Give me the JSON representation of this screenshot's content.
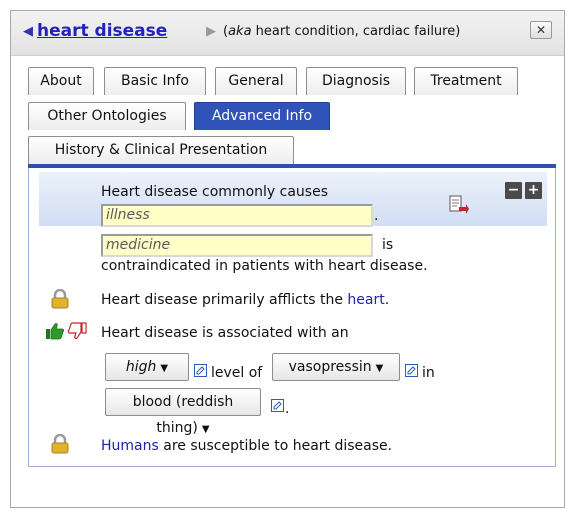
{
  "header": {
    "topic": "heart disease",
    "aka_prefix": "aka",
    "aka_text": " heart condition, cardiac failure)",
    "aka_open": "(",
    "close_label": "✕"
  },
  "tabs": [
    {
      "label": "About"
    },
    {
      "label": "Basic Info"
    },
    {
      "label": "General"
    },
    {
      "label": "Diagnosis"
    },
    {
      "label": "Treatment"
    },
    {
      "label": "Other Ontologies"
    },
    {
      "label": "Advanced Info"
    },
    {
      "label": "History & Clinical Presentation"
    }
  ],
  "active_tab": "Advanced Info",
  "facts": {
    "causes": {
      "text": "Heart disease commonly causes",
      "input_value": "illness",
      "period": ".",
      "minus": "−",
      "plus": "+"
    },
    "contraindicated": {
      "input_value": "medicine",
      "is": "is",
      "text": "contraindicated in patients with heart disease."
    },
    "afflicts": {
      "text": "Heart disease primarily afflicts the ",
      "link": "heart",
      "period": "."
    },
    "associated": {
      "text": "Heart disease is associated with an",
      "level_value": "high",
      "level_of": "level of",
      "substance_value": "vasopressin",
      "in": "in",
      "location_value": "blood (reddish thing)",
      "period": "."
    },
    "susceptible": {
      "link": "Humans",
      "text": " are susceptible to heart disease."
    }
  },
  "colors": {
    "accent": "#2f53b8",
    "link": "#2323bb",
    "input_bg": "#ffffc8"
  },
  "icons": [
    "left-arrow-icon",
    "right-arrow-icon",
    "close-icon",
    "document-arrow-icon",
    "lock-icon",
    "thumbs-up-icon",
    "thumbs-down-icon",
    "edit-icon"
  ]
}
